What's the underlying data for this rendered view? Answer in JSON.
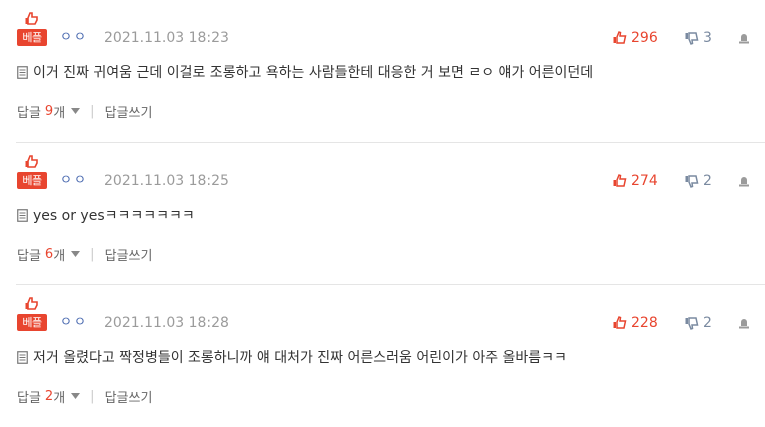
{
  "comments": [
    {
      "badge": "베플",
      "nick": "ㅇㅇ",
      "date": "2021.11.03 18:23",
      "up": "296",
      "down": "3",
      "text": "이거 진짜 귀여움 근데 이걸로 조롱하고 욕하는 사람들한테 대응한 거 보면 ㄹㅇ 얘가 어른이던데",
      "reply_label": "답글",
      "reply_count": "9",
      "reply_unit": "개",
      "write_reply": "답글쓰기"
    },
    {
      "badge": "베플",
      "nick": "ㅇㅇ",
      "date": "2021.11.03 18:25",
      "up": "274",
      "down": "2",
      "text": "yes or yesㅋㅋㅋㅋㅋㅋㅋ",
      "reply_label": "답글",
      "reply_count": "6",
      "reply_unit": "개",
      "write_reply": "답글쓰기"
    },
    {
      "badge": "베플",
      "nick": "ㅇㅇ",
      "date": "2021.11.03 18:28",
      "up": "228",
      "down": "2",
      "text": "저거 올렸다고 짝정병들이 조롱하니까 얘 대처가 진짜 어른스러움 어린이가 아주 올바름ㅋㅋ",
      "reply_label": "답글",
      "reply_count": "2",
      "reply_unit": "개",
      "write_reply": "답글쓰기"
    }
  ],
  "colors": {
    "accent": "#e8452f",
    "nick": "#4a6ab0",
    "down": "#7a8aa0"
  }
}
